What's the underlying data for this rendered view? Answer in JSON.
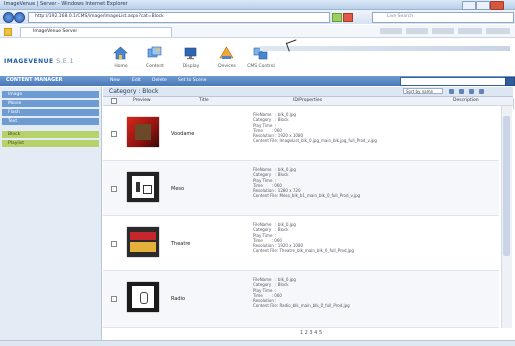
{
  "window": {
    "title": "ImageVenue | Server - Windows Internet Explorer",
    "address_url": "http://192.168.0.1/CMS/image/ImageList.aspx?cat=Block",
    "search_placeholder": "Live Search",
    "tab_title": "ImageVenue Server"
  },
  "app": {
    "logo_main": "IMAGEVENUE",
    "logo_sub": "S.E.1",
    "nav_buttons": [
      {
        "label": "Home",
        "icon": "home-icon"
      },
      {
        "label": "Content",
        "icon": "content-icon"
      },
      {
        "label": "Display",
        "icon": "display-icon"
      },
      {
        "label": "Devices",
        "icon": "devices-icon"
      },
      {
        "label": "CMS Control",
        "icon": "cms-icon"
      }
    ]
  },
  "content_manager": {
    "label": "CONTENT MANAGER",
    "tools": [
      "New",
      "Edit",
      "Delete",
      "Set to Scene"
    ]
  },
  "sidebar": {
    "items": [
      {
        "label": "Image",
        "style": "blue"
      },
      {
        "label": "Movie",
        "style": "blue"
      },
      {
        "label": "Flash",
        "style": "blue"
      },
      {
        "label": "Text",
        "style": "blue"
      },
      {
        "label": "Block",
        "style": "green"
      },
      {
        "label": "Playlist",
        "style": "green"
      }
    ]
  },
  "category": {
    "title": "Category : Block",
    "sort_label": "Sort by name",
    "columns": [
      "Preview",
      "Title",
      "ID/Properties",
      "Description"
    ]
  },
  "rows": [
    {
      "title": "Voodame",
      "info": "FileName   : blk_0.jpg\nCategory   : Block\nPlay Time  : \nTime       : 060\nResolution : 1920 x 1080\nContent File: ImageList_blk_0.jpg_main_blk.jpg_full_Prod_v.jpg"
    },
    {
      "title": "Meso",
      "info": "FileName   : blk_0.jpg\nCategory   : Block\nPlay Time  : \nTime       : 060\nResolution : 1280 x 720\nContent File: Meso_blk_b1_main_blk_0_full_Prod_v.jpg"
    },
    {
      "title": "Theatre",
      "info": "FileName   : blk_0.jpg\nCategory   : Block\nPlay Time  : \nTime       : 060\nResolution : 1920 x 1080\nContent File: Theatre_blk_main_blk_0_full_Prod.jpg"
    },
    {
      "title": "Radio",
      "info": "FileName   : blk_0.jpg\nCategory   : Block\nPlay Time  : \nTime       : 060\nResolution : \nContent File: Radio_blk_main_blk_0_full_Prod.jpg"
    }
  ],
  "pager": "1 2 3 4 5",
  "colors": {
    "accent_blue": "#4a78b8",
    "sidebar_green": "#b6d36b",
    "sidebar_blue": "#6e9bd1"
  }
}
